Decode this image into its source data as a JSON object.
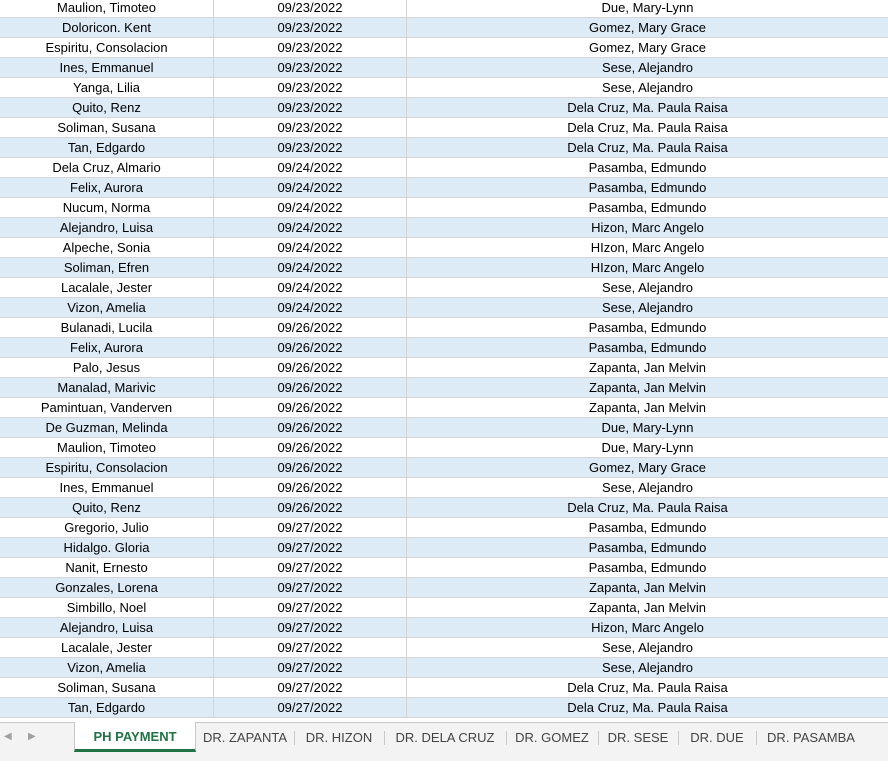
{
  "rows": [
    {
      "name": "Maulion, Timoteo",
      "date": "09/23/2022",
      "doctor": "Due, Mary-Lynn"
    },
    {
      "name": "Doloricon. Kent",
      "date": "09/23/2022",
      "doctor": "Gomez, Mary Grace"
    },
    {
      "name": "Espiritu, Consolacion",
      "date": "09/23/2022",
      "doctor": "Gomez, Mary Grace"
    },
    {
      "name": "Ines, Emmanuel",
      "date": "09/23/2022",
      "doctor": "Sese, Alejandro"
    },
    {
      "name": "Yanga, Lilia",
      "date": "09/23/2022",
      "doctor": "Sese, Alejandro"
    },
    {
      "name": "Quito, Renz",
      "date": "09/23/2022",
      "doctor": "Dela Cruz, Ma. Paula Raisa"
    },
    {
      "name": "Soliman, Susana",
      "date": "09/23/2022",
      "doctor": "Dela Cruz, Ma. Paula Raisa"
    },
    {
      "name": "Tan, Edgardo",
      "date": "09/23/2022",
      "doctor": "Dela Cruz, Ma. Paula Raisa"
    },
    {
      "name": "Dela Cruz, Almario",
      "date": "09/24/2022",
      "doctor": "Pasamba, Edmundo"
    },
    {
      "name": "Felix, Aurora",
      "date": "09/24/2022",
      "doctor": "Pasamba, Edmundo"
    },
    {
      "name": "Nucum, Norma",
      "date": "09/24/2022",
      "doctor": "Pasamba, Edmundo"
    },
    {
      "name": "Alejandro, Luisa",
      "date": "09/24/2022",
      "doctor": "Hizon, Marc Angelo"
    },
    {
      "name": "Alpeche, Sonia",
      "date": "09/24/2022",
      "doctor": "HIzon, Marc Angelo"
    },
    {
      "name": "Soliman, Efren",
      "date": "09/24/2022",
      "doctor": "HIzon, Marc Angelo"
    },
    {
      "name": "Lacalale, Jester",
      "date": "09/24/2022",
      "doctor": "Sese, Alejandro"
    },
    {
      "name": "Vizon, Amelia",
      "date": "09/24/2022",
      "doctor": "Sese, Alejandro"
    },
    {
      "name": "Bulanadi, Lucila",
      "date": "09/26/2022",
      "doctor": "Pasamba, Edmundo"
    },
    {
      "name": "Felix, Aurora",
      "date": "09/26/2022",
      "doctor": "Pasamba, Edmundo"
    },
    {
      "name": "Palo, Jesus",
      "date": "09/26/2022",
      "doctor": "Zapanta, Jan Melvin"
    },
    {
      "name": "Manalad, Marivic",
      "date": "09/26/2022",
      "doctor": "Zapanta, Jan Melvin"
    },
    {
      "name": "Pamintuan, Vanderven",
      "date": "09/26/2022",
      "doctor": "Zapanta, Jan Melvin"
    },
    {
      "name": "De Guzman, Melinda",
      "date": "09/26/2022",
      "doctor": "Due, Mary-Lynn"
    },
    {
      "name": "Maulion, Timoteo",
      "date": "09/26/2022",
      "doctor": "Due, Mary-Lynn"
    },
    {
      "name": "Espiritu, Consolacion",
      "date": "09/26/2022",
      "doctor": "Gomez, Mary Grace"
    },
    {
      "name": "Ines, Emmanuel",
      "date": "09/26/2022",
      "doctor": "Sese, Alejandro"
    },
    {
      "name": "Quito, Renz",
      "date": "09/26/2022",
      "doctor": "Dela Cruz, Ma. Paula Raisa"
    },
    {
      "name": "Gregorio, Julio",
      "date": "09/27/2022",
      "doctor": "Pasamba, Edmundo"
    },
    {
      "name": "Hidalgo. Gloria",
      "date": "09/27/2022",
      "doctor": "Pasamba, Edmundo"
    },
    {
      "name": "Nanit, Ernesto",
      "date": "09/27/2022",
      "doctor": "Pasamba, Edmundo"
    },
    {
      "name": "Gonzales, Lorena",
      "date": "09/27/2022",
      "doctor": "Zapanta, Jan Melvin"
    },
    {
      "name": "Simbillo, Noel",
      "date": "09/27/2022",
      "doctor": "Zapanta, Jan Melvin"
    },
    {
      "name": "Alejandro, Luisa",
      "date": "09/27/2022",
      "doctor": "Hizon, Marc Angelo"
    },
    {
      "name": "Lacalale, Jester",
      "date": "09/27/2022",
      "doctor": "Sese, Alejandro"
    },
    {
      "name": "Vizon, Amelia",
      "date": "09/27/2022",
      "doctor": "Sese, Alejandro"
    },
    {
      "name": "Soliman, Susana",
      "date": "09/27/2022",
      "doctor": "Dela Cruz, Ma. Paula Raisa"
    },
    {
      "name": "Tan, Edgardo",
      "date": "09/27/2022",
      "doctor": "Dela Cruz, Ma. Paula Raisa"
    }
  ],
  "tabs": [
    {
      "label": "PH PAYMENT",
      "active": true
    },
    {
      "label": "DR. ZAPANTA",
      "active": false
    },
    {
      "label": "DR. HIZON",
      "active": false
    },
    {
      "label": "DR. DELA CRUZ",
      "active": false
    },
    {
      "label": "DR. GOMEZ",
      "active": false
    },
    {
      "label": "DR. SESE",
      "active": false
    },
    {
      "label": "DR. DUE",
      "active": false
    },
    {
      "label": "DR. PASAMBA",
      "active": false
    }
  ],
  "nav": {
    "prev_icon": "◀",
    "next_icon": "▶"
  },
  "colors": {
    "band": "#ddebf7",
    "active_tab": "#217346"
  }
}
